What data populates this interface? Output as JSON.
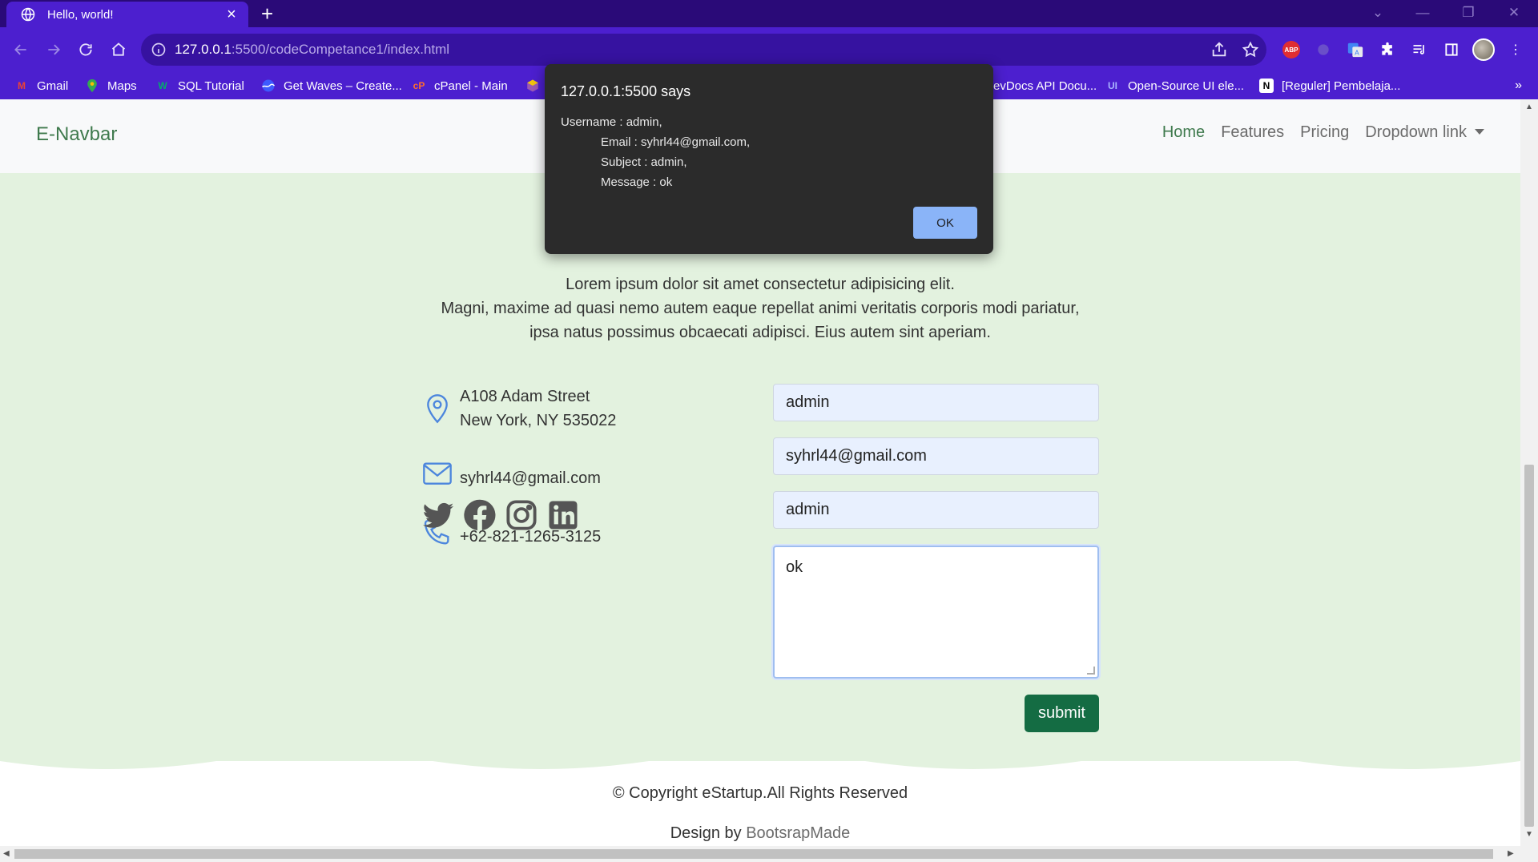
{
  "browser": {
    "tab_title": "Hello, world!",
    "url_host": "127.0.0.1",
    "url_rest": ":5500/codeCompetance1/index.html",
    "bookmarks": [
      {
        "label": "Gmail",
        "icon": "gmail-icon",
        "color": "#ea4335"
      },
      {
        "label": "Maps",
        "icon": "maps-icon",
        "color": "#34a853"
      },
      {
        "label": "SQL Tutorial",
        "icon": "w3schools-icon",
        "color": "#04aa6d"
      },
      {
        "label": "Get Waves – Create...",
        "icon": "waves-icon",
        "color": "#3d5afe"
      },
      {
        "label": "cPanel - Main",
        "icon": "cpanel-icon",
        "color": "#ff6c2c"
      },
      {
        "label": "evDocs API Docu...",
        "icon": "devdocs-icon",
        "color": "#ffffff"
      },
      {
        "label": "Open-Source UI ele...",
        "icon": "ui-icon",
        "color": "#7f8cff"
      },
      {
        "label": "[Reguler] Pembelaja...",
        "icon": "notion-icon",
        "color": "#ffffff"
      }
    ],
    "bookmarks_more": "»",
    "abp_label": "ABP"
  },
  "navbar": {
    "brand": "E-Navbar",
    "links": [
      "Home",
      "Features",
      "Pricing",
      "Dropdown link"
    ]
  },
  "contact": {
    "lead_lines": [
      "Lorem ipsum dolor sit amet consectetur adipisicing elit.",
      "Magni, maxime ad quasi nemo autem eaque repellat animi veritatis corporis modi pariatur,",
      "ipsa natus possimus obcaecati adipisci. Eius autem sint aperiam."
    ],
    "address_line1": "A108 Adam Street",
    "address_line2": "New York, NY 535022",
    "email": "syhrl44@gmail.com",
    "phone": "+62-821-1265-3125",
    "form": {
      "username": "admin",
      "email": "syhrl44@gmail.com",
      "subject": "admin",
      "message": "ok",
      "submit_label": "submit"
    }
  },
  "footer": {
    "copyright": "© Copyright eStartup.All Rights Reserved",
    "design_prefix": "Design by ",
    "design_link": "BootsrapMade"
  },
  "dialog": {
    "title": "127.0.0.1:5500 says",
    "message": "Username : admin,\n            Email : syhrl44@gmail.com,\n            Subject : admin,\n            Message : ok",
    "ok_label": "OK"
  }
}
